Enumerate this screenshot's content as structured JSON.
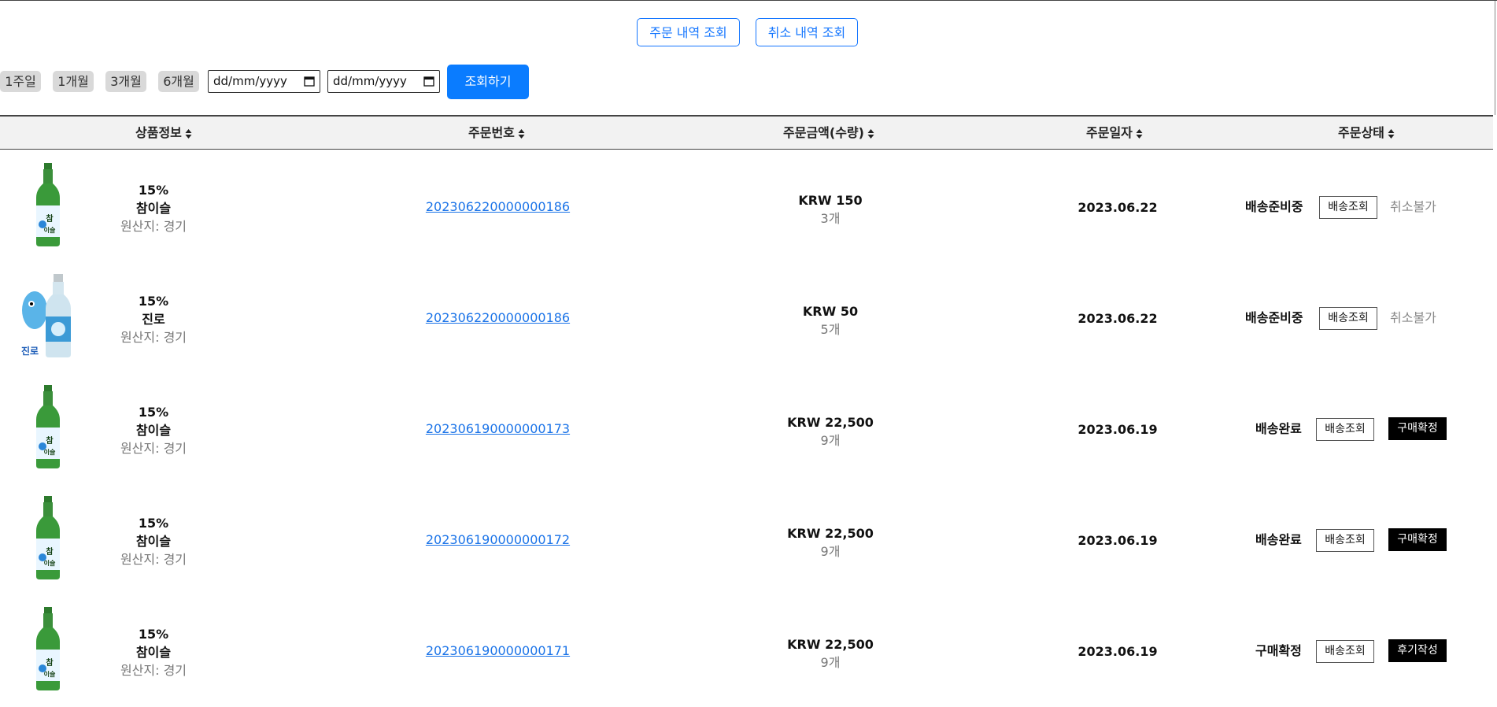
{
  "tabs": {
    "order_history": "주문 내역 조회",
    "cancel_history": "취소 내역 조회"
  },
  "filters": {
    "periods": [
      "1주일",
      "1개월",
      "3개월",
      "6개월"
    ],
    "start_date": "dd/mm/yyyy",
    "end_date": "dd/mm/yyyy",
    "search_label": "조회하기"
  },
  "table": {
    "headers": [
      "상품정보",
      "주문번호",
      "주문금액(수량)",
      "주문일자",
      "주문상태"
    ],
    "rows": [
      {
        "image": "chamisul-bottle",
        "abv": "15%",
        "name": "참이슬",
        "origin": "원산지: 경기",
        "order_no": "202306220000000186",
        "price": "KRW 150",
        "qty": "3개",
        "date": "2023.06.22",
        "status": "배송준비중",
        "track": "배송조회",
        "action": "취소불가",
        "action_style": "muted"
      },
      {
        "image": "jinro-bottle",
        "abv": "15%",
        "name": "진로",
        "origin": "원산지: 경기",
        "order_no": "202306220000000186",
        "price": "KRW 50",
        "qty": "5개",
        "date": "2023.06.22",
        "status": "배송준비중",
        "track": "배송조회",
        "action": "취소불가",
        "action_style": "muted"
      },
      {
        "image": "chamisul-bottle",
        "abv": "15%",
        "name": "참이슬",
        "origin": "원산지: 경기",
        "order_no": "202306190000000173",
        "price": "KRW 22,500",
        "qty": "9개",
        "date": "2023.06.19",
        "status": "배송완료",
        "track": "배송조회",
        "action": "구매확정",
        "action_style": "dark"
      },
      {
        "image": "chamisul-bottle",
        "abv": "15%",
        "name": "참이슬",
        "origin": "원산지: 경기",
        "order_no": "202306190000000172",
        "price": "KRW 22,500",
        "qty": "9개",
        "date": "2023.06.19",
        "status": "배송완료",
        "track": "배송조회",
        "action": "구매확정",
        "action_style": "dark"
      },
      {
        "image": "chamisul-bottle",
        "abv": "15%",
        "name": "참이슬",
        "origin": "원산지: 경기",
        "order_no": "202306190000000171",
        "price": "KRW 22,500",
        "qty": "9개",
        "date": "2023.06.19",
        "status": "구매확정",
        "track": "배송조회",
        "action": "후기작성",
        "action_style": "dark"
      }
    ]
  }
}
